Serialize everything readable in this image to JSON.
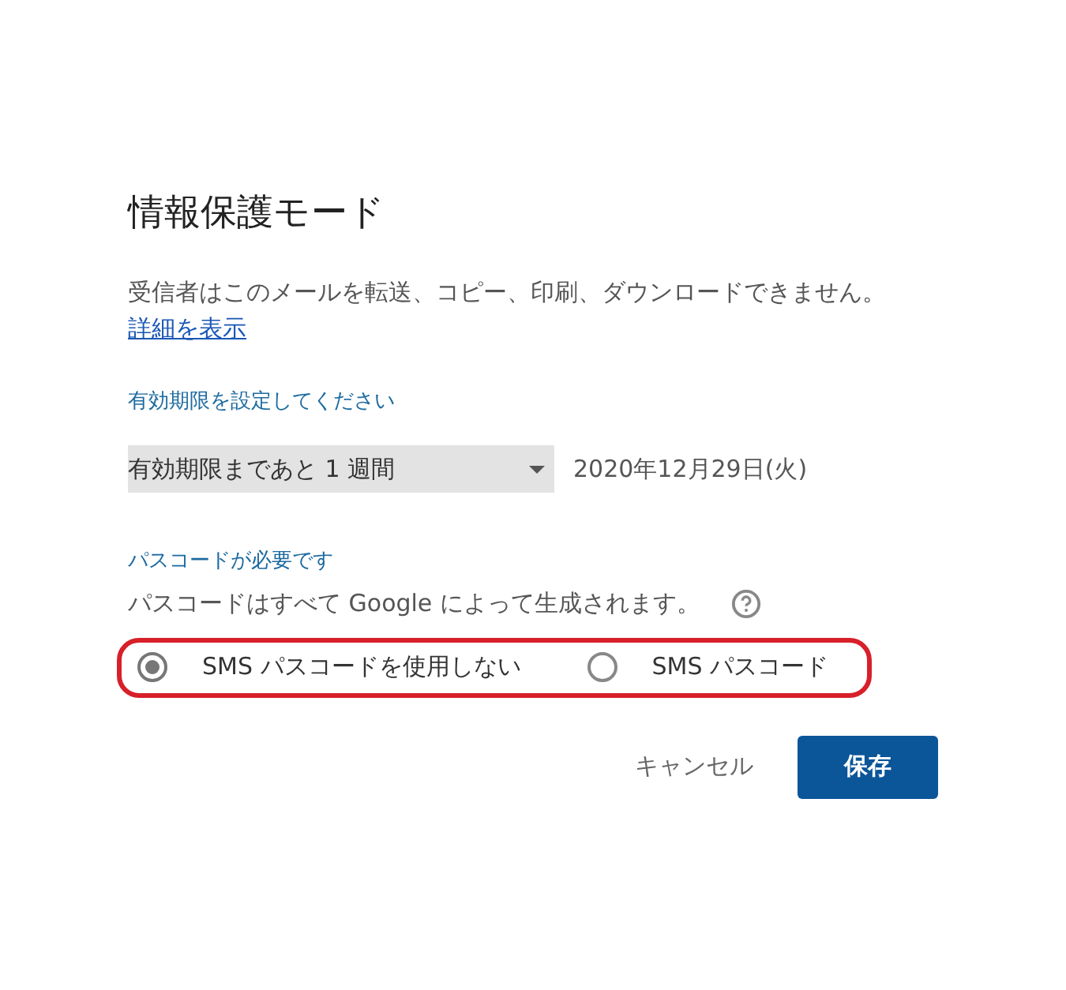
{
  "dialog": {
    "title": "情報保護モード",
    "description": "受信者はこのメールを転送、コピー、印刷、ダウンロードできません。",
    "details_link": "詳細を表示"
  },
  "expiry": {
    "label": "有効期限を設定してください",
    "select_value": "有効期限まであと 1 週間",
    "date": "2020年12月29日(火)"
  },
  "passcode": {
    "label": "パスコードが必要です",
    "description": "パスコードはすべて Google によって生成されます。",
    "highlighted": true,
    "options": [
      {
        "label": "SMS パスコードを使用しない",
        "selected": true
      },
      {
        "label": "SMS パスコード",
        "selected": false
      }
    ]
  },
  "buttons": [
    {
      "label": "キャンセル",
      "kind": "text"
    },
    {
      "label": "保存",
      "kind": "primary"
    }
  ]
}
